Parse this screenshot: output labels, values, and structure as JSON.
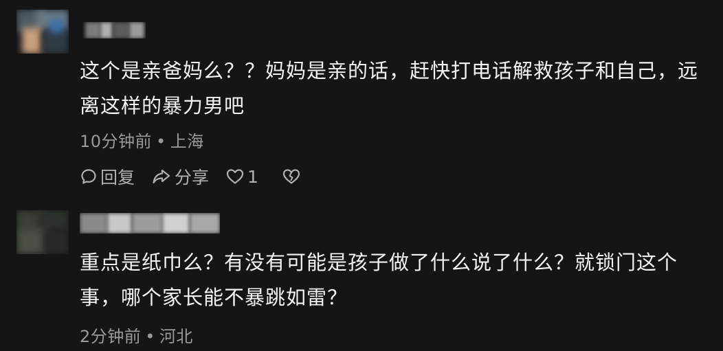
{
  "comments": [
    {
      "text": "这个是亲爸妈么？？妈妈是亲的话，赶快打电话解救孩子和自己，远离这样的暴力男吧",
      "time": "10分钟前",
      "separator": "•",
      "location": "上海",
      "actions": {
        "reply_label": "回复",
        "share_label": "分享",
        "like_count": "1"
      }
    },
    {
      "text": "重点是纸巾么？有没有可能是孩子做了什么说了什么？就锁门这个事，哪个家长能不暴跳如雷？",
      "time": "2分钟前",
      "separator": "•",
      "location": "河北"
    }
  ],
  "icons": {
    "reply": "comment-bubble-icon",
    "share": "share-arrow-icon",
    "like": "heart-icon",
    "dislike": "broken-heart-icon"
  },
  "colors": {
    "background": "#151515",
    "text": "#f3f3f3",
    "meta": "#9a9a9a",
    "action": "#b0b0b0"
  }
}
